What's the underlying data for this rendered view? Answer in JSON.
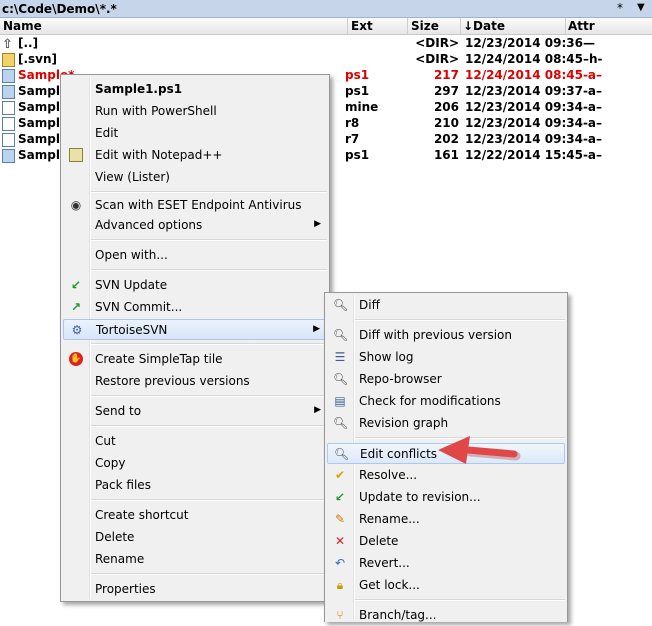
{
  "pathbar": {
    "path": "c:\\Code\\Demo\\*.*",
    "star": "*",
    "dropdown": "▼"
  },
  "columns": {
    "name": "Name",
    "ext": "Ext",
    "size": "Size",
    "date": "↓Date",
    "attr": "Attr"
  },
  "files": [
    {
      "name": "[..]",
      "ext": "",
      "size": "<DIR>",
      "date": "12/23/2014 09:36—",
      "icon": "up-arrow-icon"
    },
    {
      "name": "[.svn]",
      "ext": "",
      "size": "<DIR>",
      "date": "12/24/2014 08:45–h-",
      "icon": "svn-folder-icon"
    },
    {
      "name": "Sample*",
      "ext": "ps1",
      "size": "217",
      "date": "12/24/2014 08:45-a–",
      "icon": "ps1-file-icon",
      "selected": true
    },
    {
      "name": "Sample",
      "ext": "ps1",
      "size": "297",
      "date": "12/23/2014 09:37-a–",
      "icon": "ps1-file-icon"
    },
    {
      "name": "Sample",
      "ext": "mine",
      "size": "206",
      "date": "12/23/2014 09:34-a–",
      "icon": "file-icon"
    },
    {
      "name": "Sample",
      "ext": "r8",
      "size": "210",
      "date": "12/23/2014 09:34-a–",
      "icon": "file-icon"
    },
    {
      "name": "Sample",
      "ext": "r7",
      "size": "202",
      "date": "12/23/2014 09:34-a–",
      "icon": "file-icon"
    },
    {
      "name": "Sample",
      "ext": "ps1",
      "size": "161",
      "date": "12/22/2014 15:45-a–",
      "icon": "ps1-file-icon"
    }
  ],
  "context_menu": {
    "items": [
      {
        "label": "Sample1.ps1",
        "bold": true
      },
      {
        "label": "Run with PowerShell"
      },
      {
        "label": "Edit"
      },
      {
        "label": "Edit with Notepad++",
        "icon": "notepad-icon"
      },
      {
        "label": "View (Lister)"
      },
      {
        "label": "Scan with ESET Endpoint Antivirus",
        "icon": "eset-icon"
      },
      {
        "label": "Advanced options",
        "submenu": true
      },
      {
        "label": "Open with..."
      },
      {
        "label": "SVN Update",
        "icon": "svn-update-icon"
      },
      {
        "label": "SVN Commit...",
        "icon": "svn-commit-icon"
      },
      {
        "label": "TortoiseSVN",
        "icon": "tortoise-icon",
        "submenu": true
      },
      {
        "label": "Create SimpleTap tile",
        "icon": "simpletap-icon"
      },
      {
        "label": "Restore previous versions"
      },
      {
        "label": "Send to",
        "submenu": true
      },
      {
        "label": "Cut"
      },
      {
        "label": "Copy"
      },
      {
        "label": "Pack files"
      },
      {
        "label": "Create shortcut"
      },
      {
        "label": "Delete"
      },
      {
        "label": "Rename"
      },
      {
        "label": "Properties"
      }
    ]
  },
  "submenu": {
    "items": [
      {
        "label": "Diff",
        "icon": "diff-icon"
      },
      {
        "label": "Diff with previous version",
        "icon": "diff-prev-icon"
      },
      {
        "label": "Show log",
        "icon": "log-icon"
      },
      {
        "label": "Repo-browser",
        "icon": "repo-browser-icon"
      },
      {
        "label": "Check for modifications",
        "icon": "check-mod-icon"
      },
      {
        "label": "Revision graph",
        "icon": "revision-graph-icon"
      },
      {
        "label": "Edit conflicts",
        "icon": "edit-conflicts-icon"
      },
      {
        "label": "Resolve...",
        "icon": "resolve-icon"
      },
      {
        "label": "Update to revision...",
        "icon": "update-revision-icon"
      },
      {
        "label": "Rename...",
        "icon": "rename-icon"
      },
      {
        "label": "Delete",
        "icon": "delete-icon"
      },
      {
        "label": "Revert...",
        "icon": "revert-icon"
      },
      {
        "label": "Get lock...",
        "icon": "lock-icon"
      },
      {
        "label": "Branch/tag...",
        "icon": "branch-icon"
      }
    ]
  },
  "colors": {
    "selected_text": "#e00000",
    "arrow": "#e04848",
    "highlight": "#dde9f9"
  }
}
